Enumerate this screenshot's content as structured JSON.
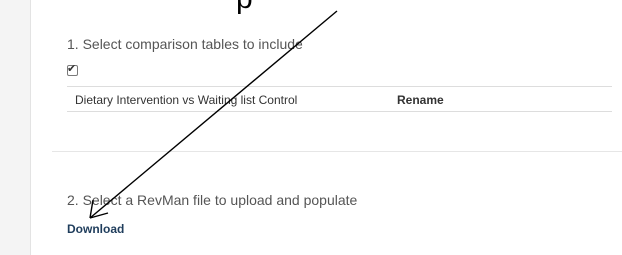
{
  "top_fragment": "p",
  "step1": {
    "title": "1. Select comparison tables to include",
    "checkbox_checked": true,
    "table": {
      "rows": [
        {
          "name": "Dietary Intervention vs Waiting list Control",
          "action": "Rename"
        }
      ]
    }
  },
  "step2": {
    "title": "2. Select a RevMan file to upload and populate",
    "download_label": "Download"
  },
  "annotation": {
    "icon": "arrow-icon",
    "color": "#000000"
  }
}
